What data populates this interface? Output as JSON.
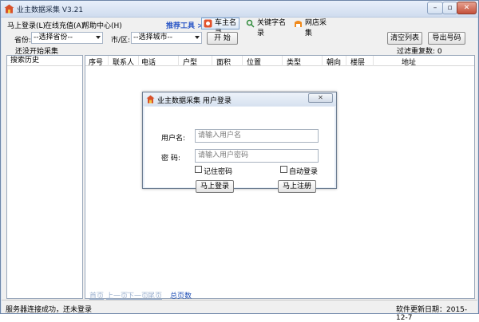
{
  "window": {
    "title": "业主数据采集 V3.21"
  },
  "menu": {
    "items": [
      "马上登录(L)",
      "在线充值(A)",
      "帮助中心(H)"
    ]
  },
  "toolbar": {
    "label": "推荐工具 >>",
    "buttons": [
      {
        "label": "车主名录",
        "icon": "car-owner-icon"
      },
      {
        "label": "关键字名录",
        "icon": "keyword-icon"
      },
      {
        "label": "网店采集",
        "icon": "shop-icon"
      }
    ]
  },
  "filters": {
    "province_label": "省份:",
    "province_value": "--选择省份--",
    "city_label": "市/区:",
    "city_value": "--选择城市--",
    "start_button": "开 始",
    "clear_button": "清空列表",
    "export_button": "导出号码",
    "status": "还没开始采集",
    "dedupe": "过滤重复数: 0"
  },
  "left_panel": {
    "header": "搜索历史"
  },
  "grid": {
    "columns": [
      "序号",
      "联系人",
      "电话",
      "户型",
      "面积",
      "位置",
      "类型",
      "朝向",
      "楼层",
      "地址"
    ]
  },
  "pager": {
    "first": "首页",
    "prev": "上一页",
    "next": "下一页",
    "last": "尾页",
    "total": "总页数"
  },
  "status": {
    "left": "服务器连接成功，还未登录",
    "right": "软件更新日期：2015-12-7"
  },
  "dialog": {
    "title": "业主数据采集 用户登录",
    "username_label": "用户名:",
    "username_placeholder": "请输入用户名",
    "password_label": "密   码:",
    "password_placeholder": "请输入用户密码",
    "remember_label": "记住密码",
    "remember_checked": false,
    "autologin_label": "自动登录",
    "autologin_checked": false,
    "login_button": "马上登录",
    "register_button": "马上注册"
  },
  "colors": {
    "accent": "#2a56c6",
    "pager_disabled": "#9bb0cf",
    "pager_total": "#1f4fb6"
  }
}
